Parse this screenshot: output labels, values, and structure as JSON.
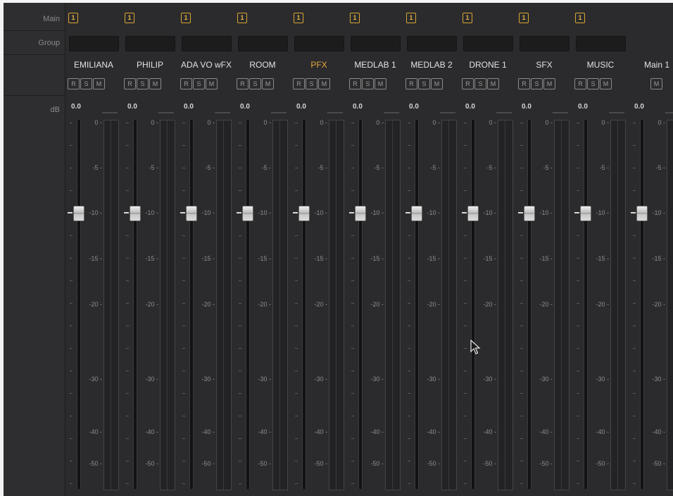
{
  "row_labels": {
    "main": "Main",
    "group": "Group",
    "db": "dB"
  },
  "scale_labels": [
    "0",
    "-5",
    "-10",
    "-15",
    "-20",
    "-30",
    "-40",
    "-50"
  ],
  "fader_level_db": -10,
  "channels": [
    {
      "name": "EMILIANA",
      "main_assign": "1",
      "db": "0.0",
      "rsm": [
        "R",
        "S",
        "M"
      ]
    },
    {
      "name": "PHILIP",
      "main_assign": "1",
      "db": "0.0",
      "rsm": [
        "R",
        "S",
        "M"
      ]
    },
    {
      "name": "ADA VO wFX",
      "main_assign": "1",
      "db": "0.0",
      "rsm": [
        "R",
        "S",
        "M"
      ]
    },
    {
      "name": "ROOM",
      "main_assign": "1",
      "db": "0.0",
      "rsm": [
        "R",
        "S",
        "M"
      ]
    },
    {
      "name": "PFX",
      "main_assign": "1",
      "db": "0.0",
      "rsm": [
        "R",
        "S",
        "M"
      ],
      "highlight_color": "#e8a93a"
    },
    {
      "name": "MEDLAB 1",
      "main_assign": "1",
      "db": "0.0",
      "rsm": [
        "R",
        "S",
        "M"
      ]
    },
    {
      "name": "MEDLAB 2",
      "main_assign": "1",
      "db": "0.0",
      "rsm": [
        "R",
        "S",
        "M"
      ]
    },
    {
      "name": "DRONE 1",
      "main_assign": "1",
      "db": "0.0",
      "rsm": [
        "R",
        "S",
        "M"
      ]
    },
    {
      "name": "SFX",
      "main_assign": "1",
      "db": "0.0",
      "rsm": [
        "R",
        "S",
        "M"
      ]
    },
    {
      "name": "MUSIC",
      "main_assign": "1",
      "db": "0.0",
      "rsm": [
        "R",
        "S",
        "M"
      ]
    }
  ],
  "main_bus": {
    "name": "Main 1",
    "db": "0.0",
    "mute": "M"
  },
  "colors": {
    "panel": "#2b2b2d",
    "badge_accent": "#d9a532",
    "text": "#e2e2e2"
  },
  "icons": {
    "cursor": "mouse-pointer-icon"
  }
}
